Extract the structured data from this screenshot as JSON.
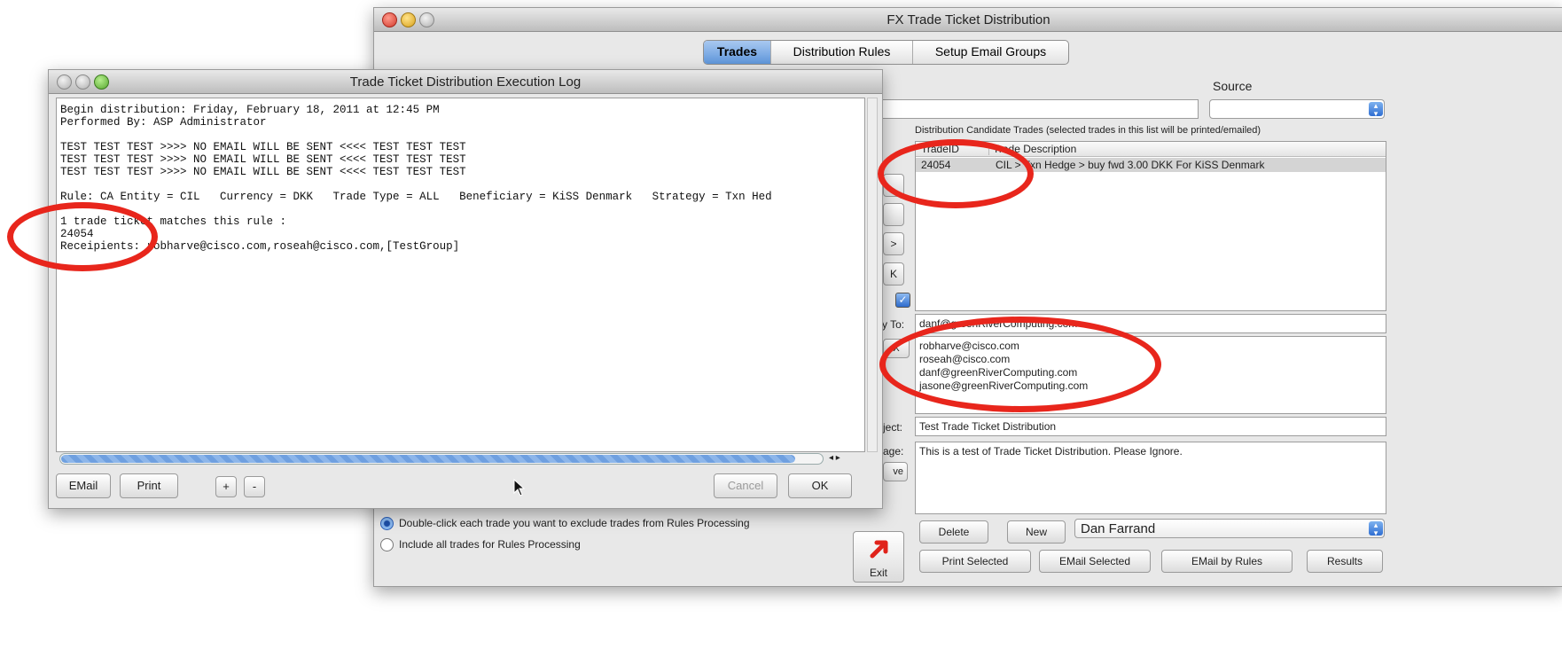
{
  "main_window": {
    "title": "FX Trade Ticket Distribution",
    "tabs": [
      "Trades",
      "Distribution Rules",
      "Setup Email Groups"
    ],
    "active_tab": "Trades",
    "source_label": "Source",
    "candidates_caption": "Distribution Candidate Trades (selected trades in this list will be printed/emailed)",
    "table_headers": [
      "TradeID",
      "Trade Description"
    ],
    "table_rows": [
      {
        "id": "24054",
        "description": "CIL  >  Txn Hedge  >  buy fwd 3.00 DKK  For KiSS Denmark"
      }
    ],
    "reply_to_label": "y To:",
    "reply_to_value": "danf@greenRiverComputing.com",
    "recipients": [
      "robharve@cisco.com",
      "roseah@cisco.com",
      "danf@greenRiverComputing.com",
      "jasone@greenRiverComputing.com"
    ],
    "subject_label": "ject:",
    "subject_value": "Test Trade Ticket Distribution",
    "message_label": "age:",
    "message_value": "This is a test of Trade Ticket Distribution.  Please Ignore.",
    "radio_options": [
      "Double-click each trade you want to exclude trades from Rules Processing",
      "Include all trades for Rules Processing"
    ],
    "selected_radio": 0,
    "delete_label": "Delete",
    "new_label": "New",
    "user_select_value": "Dan Farrand",
    "exit_label": "Exit",
    "print_selected_label": "Print Selected",
    "email_selected_label": "EMail Selected",
    "email_by_rules_label": "EMail by Rules",
    "results_label": "Results",
    "partial_button_glyphs": [
      "X",
      ">",
      "K"
    ],
    "partial_label_ve": "ve"
  },
  "log_window": {
    "title": "Trade Ticket Distribution Execution Log",
    "log_lines": [
      "Begin distribution: Friday, February 18, 2011 at 12:45 PM",
      "Performed By: ASP Administrator",
      "",
      "TEST TEST TEST >>>> NO EMAIL WILL BE SENT <<<< TEST TEST TEST",
      "TEST TEST TEST >>>> NO EMAIL WILL BE SENT <<<< TEST TEST TEST",
      "TEST TEST TEST >>>> NO EMAIL WILL BE SENT <<<< TEST TEST TEST",
      "",
      "Rule: CA Entity = CIL   Currency = DKK   Trade Type = ALL   Beneficiary = KiSS Denmark   Strategy = Txn Hed",
      "",
      "1 trade ticket matches this rule :",
      "24054",
      "Receipients: robharve@cisco.com,roseah@cisco.com,[TestGroup]"
    ],
    "email_label": "EMail",
    "print_label": "Print",
    "plus_label": "+",
    "minus_label": "-",
    "cancel_label": "Cancel",
    "ok_label": "OK",
    "scroll_arrows": "◂ ▸"
  },
  "colors": {
    "annotation_red": "#e8261c",
    "scroll_blue": "#6fa0e0",
    "selection_gray": "#d4d4d4"
  }
}
